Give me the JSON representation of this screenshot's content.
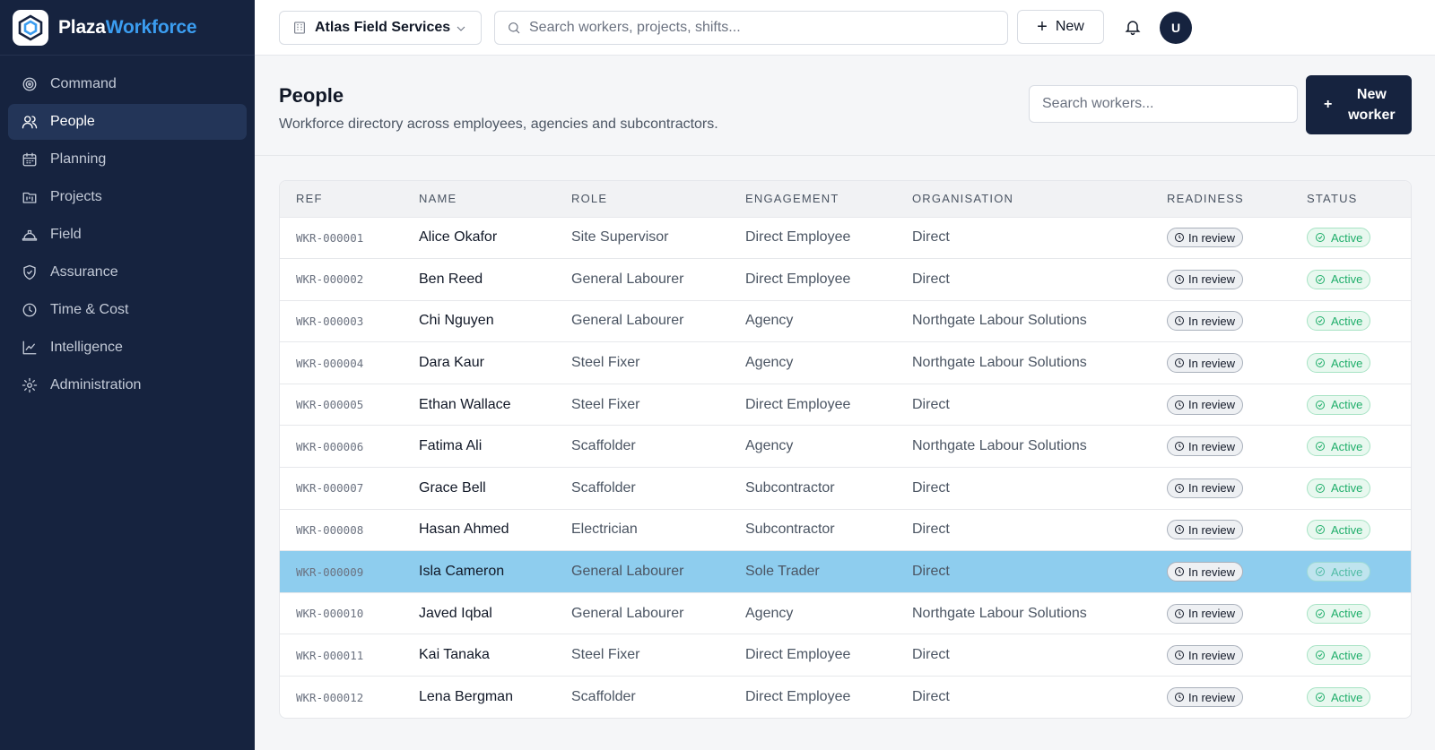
{
  "brand": {
    "part1": "Plaza",
    "part2": "Workforce"
  },
  "sidebar": {
    "items": [
      {
        "label": "Command",
        "icon": "target-icon"
      },
      {
        "label": "People",
        "icon": "users-icon",
        "active": true
      },
      {
        "label": "Planning",
        "icon": "calendar-icon"
      },
      {
        "label": "Projects",
        "icon": "kanban-icon"
      },
      {
        "label": "Field",
        "icon": "hardhat-icon"
      },
      {
        "label": "Assurance",
        "icon": "shield-icon"
      },
      {
        "label": "Time & Cost",
        "icon": "clock-icon"
      },
      {
        "label": "Intelligence",
        "icon": "chart-line-icon"
      },
      {
        "label": "Administration",
        "icon": "gear-icon"
      }
    ]
  },
  "topbar": {
    "org_name": "Atlas Field Services",
    "search_placeholder": "Search workers, projects, shifts...",
    "new_label": "New",
    "avatar_initial": "U"
  },
  "page": {
    "title": "People",
    "subtitle": "Workforce directory across employees, agencies and subcontractors.",
    "search_placeholder": "Search workers...",
    "new_worker_line1": "New",
    "new_worker_line2": "worker"
  },
  "table": {
    "columns": [
      "REF",
      "NAME",
      "ROLE",
      "ENGAGEMENT",
      "ORGANISATION",
      "READINESS",
      "STATUS"
    ],
    "rows": [
      {
        "ref": "WKR-000001",
        "name": "Alice Okafor",
        "role": "Site Supervisor",
        "engagement": "Direct Employee",
        "organisation": "Direct",
        "readiness": "In review",
        "status": "Active"
      },
      {
        "ref": "WKR-000002",
        "name": "Ben Reed",
        "role": "General Labourer",
        "engagement": "Direct Employee",
        "organisation": "Direct",
        "readiness": "In review",
        "status": "Active"
      },
      {
        "ref": "WKR-000003",
        "name": "Chi Nguyen",
        "role": "General Labourer",
        "engagement": "Agency",
        "organisation": "Northgate Labour Solutions",
        "readiness": "In review",
        "status": "Active"
      },
      {
        "ref": "WKR-000004",
        "name": "Dara Kaur",
        "role": "Steel Fixer",
        "engagement": "Agency",
        "organisation": "Northgate Labour Solutions",
        "readiness": "In review",
        "status": "Active"
      },
      {
        "ref": "WKR-000005",
        "name": "Ethan Wallace",
        "role": "Steel Fixer",
        "engagement": "Direct Employee",
        "organisation": "Direct",
        "readiness": "In review",
        "status": "Active"
      },
      {
        "ref": "WKR-000006",
        "name": "Fatima Ali",
        "role": "Scaffolder",
        "engagement": "Agency",
        "organisation": "Northgate Labour Solutions",
        "readiness": "In review",
        "status": "Active"
      },
      {
        "ref": "WKR-000007",
        "name": "Grace Bell",
        "role": "Scaffolder",
        "engagement": "Subcontractor",
        "organisation": "Direct",
        "readiness": "In review",
        "status": "Active"
      },
      {
        "ref": "WKR-000008",
        "name": "Hasan Ahmed",
        "role": "Electrician",
        "engagement": "Subcontractor",
        "organisation": "Direct",
        "readiness": "In review",
        "status": "Active"
      },
      {
        "ref": "WKR-000009",
        "name": "Isla Cameron",
        "role": "General Labourer",
        "engagement": "Sole Trader",
        "organisation": "Direct",
        "readiness": "In review",
        "status": "Active",
        "selected": true
      },
      {
        "ref": "WKR-000010",
        "name": "Javed Iqbal",
        "role": "General Labourer",
        "engagement": "Agency",
        "organisation": "Northgate Labour Solutions",
        "readiness": "In review",
        "status": "Active"
      },
      {
        "ref": "WKR-000011",
        "name": "Kai Tanaka",
        "role": "Steel Fixer",
        "engagement": "Direct Employee",
        "organisation": "Direct",
        "readiness": "In review",
        "status": "Active"
      },
      {
        "ref": "WKR-000012",
        "name": "Lena Bergman",
        "role": "Scaffolder",
        "engagement": "Direct Employee",
        "organisation": "Direct",
        "readiness": "In review",
        "status": "Active"
      }
    ]
  },
  "colors": {
    "sidebar_bg": "#16233f",
    "accent": "#3b9df0",
    "selected_row": "#8ecdee",
    "active_green": "#1fae6a"
  }
}
